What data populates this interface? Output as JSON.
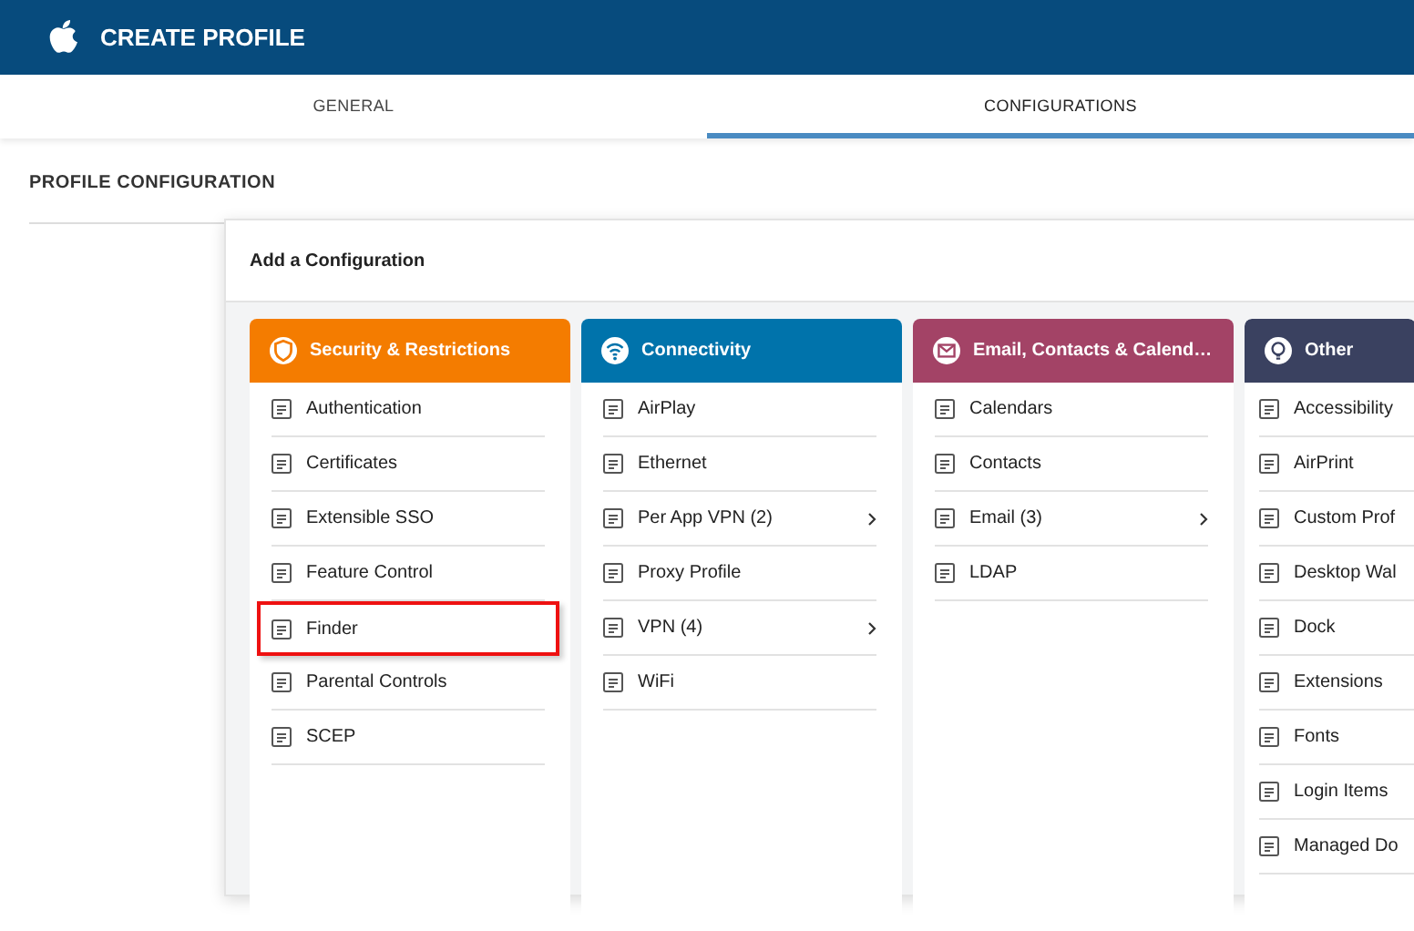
{
  "header": {
    "title": "CREATE PROFILE"
  },
  "tabs": [
    {
      "label": "GENERAL",
      "selected": false
    },
    {
      "label": "CONFIGURATIONS",
      "selected": true
    }
  ],
  "section": {
    "title": "PROFILE CONFIGURATION"
  },
  "dialog": {
    "title": "Add a Configuration",
    "categories": [
      {
        "name": "Security & Restrictions",
        "color": "#f47c00",
        "kind": "shield",
        "items": [
          {
            "label": "Authentication",
            "highlighted": false,
            "has_submenu": false
          },
          {
            "label": "Certificates",
            "highlighted": false,
            "has_submenu": false
          },
          {
            "label": "Extensible SSO",
            "highlighted": false,
            "has_submenu": false
          },
          {
            "label": "Feature Control",
            "highlighted": false,
            "has_submenu": false
          },
          {
            "label": "Finder",
            "highlighted": true,
            "has_submenu": false
          },
          {
            "label": "Parental Controls",
            "highlighted": false,
            "has_submenu": false
          },
          {
            "label": "SCEP",
            "highlighted": false,
            "has_submenu": false
          }
        ]
      },
      {
        "name": "Connectivity",
        "color": "#0073ab",
        "kind": "wifi",
        "items": [
          {
            "label": "AirPlay",
            "highlighted": false,
            "has_submenu": false
          },
          {
            "label": "Ethernet",
            "highlighted": false,
            "has_submenu": false
          },
          {
            "label": "Per App VPN (2)",
            "highlighted": false,
            "has_submenu": true
          },
          {
            "label": "Proxy Profile",
            "highlighted": false,
            "has_submenu": false
          },
          {
            "label": "VPN (4)",
            "highlighted": false,
            "has_submenu": true
          },
          {
            "label": "WiFi",
            "highlighted": false,
            "has_submenu": false
          }
        ]
      },
      {
        "name": "Email, Contacts & Calend…",
        "color": "#a34366",
        "kind": "mail",
        "items": [
          {
            "label": "Calendars",
            "highlighted": false,
            "has_submenu": false
          },
          {
            "label": "Contacts",
            "highlighted": false,
            "has_submenu": false
          },
          {
            "label": "Email (3)",
            "highlighted": false,
            "has_submenu": true
          },
          {
            "label": "LDAP",
            "highlighted": false,
            "has_submenu": false
          }
        ]
      },
      {
        "name": "Other",
        "color": "#3a4160",
        "kind": "bulb",
        "items": [
          {
            "label": "Accessibility",
            "highlighted": false,
            "has_submenu": false
          },
          {
            "label": "AirPrint",
            "highlighted": false,
            "has_submenu": false
          },
          {
            "label": "Custom Prof",
            "highlighted": false,
            "has_submenu": false
          },
          {
            "label": "Desktop Wal",
            "highlighted": false,
            "has_submenu": false
          },
          {
            "label": "Dock",
            "highlighted": false,
            "has_submenu": false
          },
          {
            "label": "Extensions",
            "highlighted": false,
            "has_submenu": false
          },
          {
            "label": "Fonts",
            "highlighted": false,
            "has_submenu": false
          },
          {
            "label": "Login Items",
            "highlighted": false,
            "has_submenu": false
          },
          {
            "label": "Managed Do",
            "highlighted": false,
            "has_submenu": false
          }
        ]
      }
    ]
  }
}
